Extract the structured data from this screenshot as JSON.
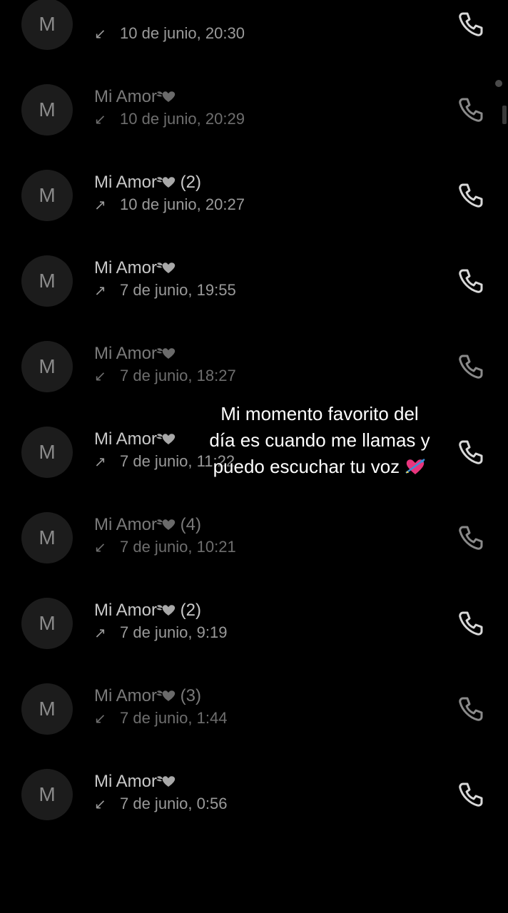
{
  "calls": [
    {
      "avatar_letter": "M",
      "name": "",
      "count": "",
      "direction": "incoming",
      "time": "10 de junio, 20:30",
      "dim": false
    },
    {
      "avatar_letter": "M",
      "name": "Mi Amor",
      "count": "",
      "direction": "incoming",
      "time": "10 de junio, 20:29",
      "dim": true
    },
    {
      "avatar_letter": "M",
      "name": "Mi Amor",
      "count": "(2)",
      "direction": "outgoing",
      "time": "10 de junio, 20:27",
      "dim": false
    },
    {
      "avatar_letter": "M",
      "name": "Mi Amor",
      "count": "",
      "direction": "outgoing",
      "time": "7 de junio, 19:55",
      "dim": false
    },
    {
      "avatar_letter": "M",
      "name": "Mi Amor",
      "count": "",
      "direction": "incoming",
      "time": "7 de junio, 18:27",
      "dim": true
    },
    {
      "avatar_letter": "M",
      "name": "Mi Amor",
      "count": "",
      "direction": "outgoing",
      "time": "7 de junio, 11:22",
      "dim": false
    },
    {
      "avatar_letter": "M",
      "name": "Mi Amor",
      "count": "(4)",
      "direction": "incoming",
      "time": "7 de junio, 10:21",
      "dim": true
    },
    {
      "avatar_letter": "M",
      "name": "Mi Amor",
      "count": "(2)",
      "direction": "outgoing",
      "time": "7 de junio, 9:19",
      "dim": false
    },
    {
      "avatar_letter": "M",
      "name": "Mi Amor",
      "count": "(3)",
      "direction": "incoming",
      "time": "7 de junio, 1:44",
      "dim": true
    },
    {
      "avatar_letter": "M",
      "name": "Mi Amor",
      "count": "",
      "direction": "incoming",
      "time": "7 de junio, 0:56",
      "dim": false
    }
  ],
  "caption": {
    "line1": "Mi momento favorito del",
    "line2": "día es cuando me llamas y",
    "line3": "puedo escuchar tu voz"
  },
  "colors": {
    "background": "#000000",
    "caption_text": "#ffffff",
    "emoji_heart": "#e8357d",
    "row_text": "#c9c9c9",
    "dim_text": "#7a7a7a"
  },
  "icons": {
    "incoming": "arrow-down-left-icon",
    "outgoing": "arrow-up-right-icon",
    "call": "phone-icon",
    "name_suffix": "winged-heart-icon",
    "caption_suffix": "heart-with-arrow-icon"
  }
}
